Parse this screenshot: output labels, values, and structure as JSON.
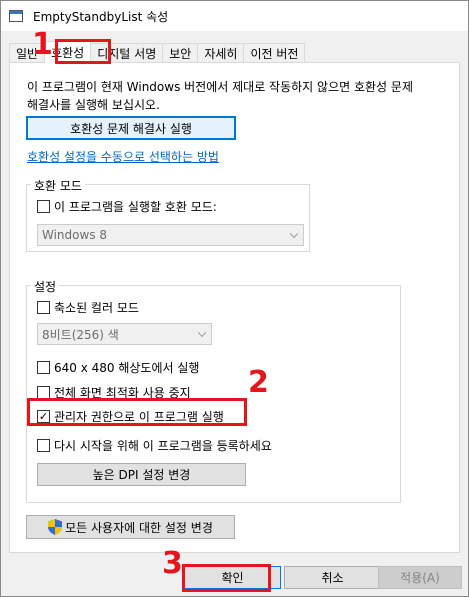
{
  "window": {
    "title": "EmptyStandbyList 속성"
  },
  "tabs": [
    {
      "label": "일반"
    },
    {
      "label": "호환성"
    },
    {
      "label": "디지털 서명"
    },
    {
      "label": "보안"
    },
    {
      "label": "자세히"
    },
    {
      "label": "이전 버전"
    }
  ],
  "compat": {
    "description": "이 프로그램이 현재 Windows 버전에서 제대로 작동하지 않으면 호환성 문제 해결사를 실행해 보십시오.",
    "troubleshooter_button": "호환성 문제 해결사 실행",
    "manual_link": "호환성 설정을 수동으로 선택하는 방법"
  },
  "compat_mode": {
    "group_label": "호환 모드",
    "checkbox_label": "이 프로그램을 실행할 호환 모드:",
    "checked": false,
    "select_value": "Windows 8"
  },
  "settings": {
    "group_label": "설정",
    "reduced_color": {
      "label": "축소된 컬러 모드",
      "checked": false
    },
    "color_select_value": "8비트(256) 색",
    "res_640": {
      "label": "640 x 480 해상도에서 실행",
      "checked": false
    },
    "fullscreen_opt": {
      "label": "전체 화면 최적화 사용 중지",
      "checked": false
    },
    "run_as_admin": {
      "label": "관리자 권한으로 이 프로그램 실행",
      "checked": true
    },
    "register_restart": {
      "label": "다시 시작을 위해 이 프로그램을 등록하세요",
      "checked": false
    },
    "dpi_button": "높은 DPI 설정 변경"
  },
  "all_users_button": "모든 사용자에 대한 설정 변경",
  "footer": {
    "ok": "확인",
    "cancel": "취소",
    "apply": "적용(A)"
  },
  "annotations": {
    "step1": "1",
    "step2": "2",
    "step3": "3",
    "color": "#e8141c"
  },
  "check_glyph": "✓"
}
